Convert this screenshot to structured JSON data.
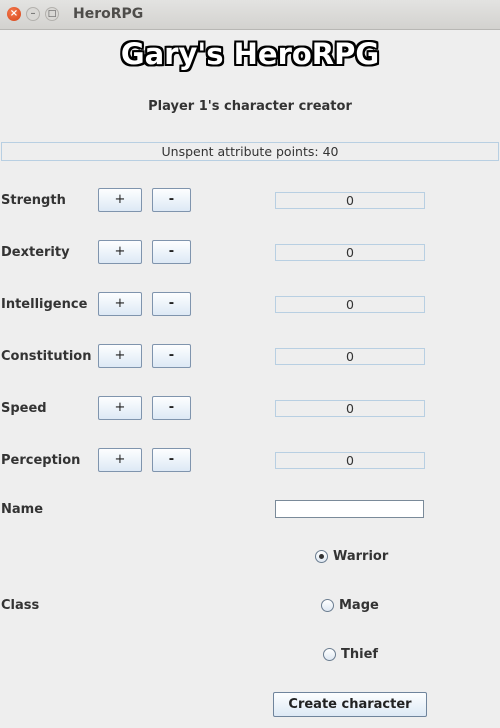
{
  "window": {
    "title": "HeroRPG",
    "close_glyph": "×",
    "min_glyph": "–",
    "max_glyph": "□"
  },
  "header": {
    "title": "Gary's HeroRPG",
    "subtitle": "Player 1's character creator"
  },
  "points": {
    "text": "Unspent attribute points: 40"
  },
  "attributes": [
    {
      "label": "Strength",
      "plus": "+",
      "minus": "-",
      "value": "0"
    },
    {
      "label": "Dexterity",
      "plus": "+",
      "minus": "-",
      "value": "0"
    },
    {
      "label": "Intelligence",
      "plus": "+",
      "minus": "-",
      "value": "0"
    },
    {
      "label": "Constitution",
      "plus": "+",
      "minus": "-",
      "value": "0"
    },
    {
      "label": "Speed",
      "plus": "+",
      "minus": "-",
      "value": "0"
    },
    {
      "label": "Perception",
      "plus": "+",
      "minus": "-",
      "value": "0"
    }
  ],
  "name": {
    "label": "Name",
    "value": ""
  },
  "class": {
    "label": "Class",
    "options": [
      {
        "label": "Warrior",
        "selected": true
      },
      {
        "label": "Mage",
        "selected": false
      },
      {
        "label": "Thief",
        "selected": false
      }
    ]
  },
  "create_button": {
    "label": "Create character"
  }
}
